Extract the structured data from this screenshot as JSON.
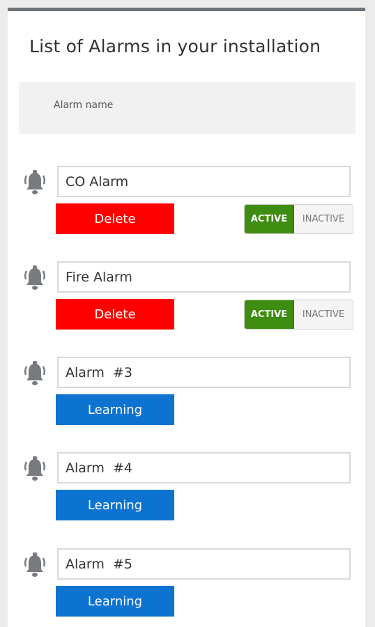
{
  "page": {
    "title": "List of Alarms in your installation"
  },
  "header": {
    "column_label": "Alarm name"
  },
  "colors": {
    "delete": "#fe0000",
    "learning": "#0c73d0",
    "active": "#3f8d10",
    "icon": "#777b7f"
  },
  "alarms": [
    {
      "name": "CO Alarm",
      "icon": "alarm-bell-icon",
      "action_label": "Delete",
      "toggle": {
        "active_label": "ACTIVE",
        "inactive_label": "INACTIVE",
        "state": "active"
      }
    },
    {
      "name": "Fire Alarm",
      "icon": "alarm-bell-icon",
      "action_label": "Delete",
      "toggle": {
        "active_label": "ACTIVE",
        "inactive_label": "INACTIVE",
        "state": "active"
      }
    },
    {
      "name": "Alarm  #3",
      "icon": "alarm-bell-icon",
      "action_label": "Learning"
    },
    {
      "name": "Alarm  #4",
      "icon": "alarm-bell-icon",
      "action_label": "Learning"
    },
    {
      "name": "Alarm  #5",
      "icon": "alarm-bell-icon",
      "action_label": "Learning"
    }
  ]
}
